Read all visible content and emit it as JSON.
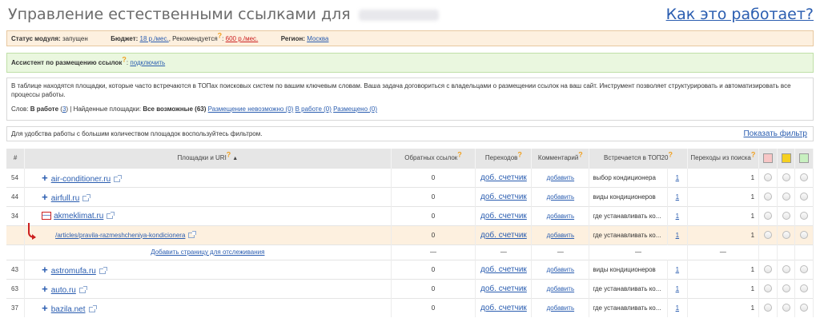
{
  "header": {
    "title": "Управление естественными ссылками для",
    "how_link": "Как это работает?"
  },
  "status": {
    "module_label": "Статус модуля:",
    "module_value": "запущен",
    "budget_label": "Бюджет:",
    "budget_value": "18 р./мес.",
    "recommended_label": "Рекомендуется",
    "recommended_value": "600 р./мес.",
    "region_label": "Регион:",
    "region_value": "Москва"
  },
  "assistant": {
    "label": "Ассистент по размещению ссылок",
    "action": "подключить"
  },
  "info": {
    "text": "В таблице находятся площадки, которые часто встречаются в ТОПах поисковых систем по вашим ключевым словам. Ваша задача договориться с владельцами о размещении ссылок на ваш сайт. Инструмент позволяет структурировать и автоматизировать все процессы работы.",
    "words_label": "Слов:",
    "in_work_label": "В работе",
    "in_work_count": "3",
    "found_label": "Найденные площадки",
    "all_possible": "Все возможные (63)",
    "impossible": "Размещение невозможно (0)",
    "in_work_sites": "В работе (0)",
    "placed": "Размещено (0)"
  },
  "filter": {
    "text": "Для удобства работы с большим количеством площадок воспользуйтесь фильтром.",
    "show_filter": "Показать фильтр"
  },
  "table": {
    "headers": {
      "num": "#",
      "sites": "Площадки и URI",
      "backlinks": "Обратных ссылок",
      "transitions": "Переходов",
      "comment": "Комментарий",
      "top20": "Встречается в ТОП20",
      "search_clicks": "Переходы из поиска"
    },
    "status_colors": [
      "#f7c6c6",
      "#f5d020",
      "#c8f0c0"
    ],
    "counter_label": "доб. счетчик",
    "add_label": "добавить",
    "rows": [
      {
        "num": "54",
        "site": "air-conditioner.ru",
        "backlinks": "0",
        "query": "выбор кондиционера",
        "top": "1",
        "clicks": "1"
      },
      {
        "num": "44",
        "site": "airfull.ru",
        "backlinks": "0",
        "query": "виды кондиционеров",
        "top": "1",
        "clicks": "1"
      },
      {
        "num": "34",
        "site": "akmeklimat.ru",
        "backlinks": "0",
        "query": "где устанавливать ко...",
        "top": "1",
        "clicks": "1"
      }
    ],
    "subrow": {
      "uri": "/articles/pravila-razmeshcheniya-kondicionera",
      "backlinks": "0",
      "query": "где устанавливать ко...",
      "top": "1",
      "clicks": "1"
    },
    "add_page": {
      "label": "Добавить страницу для отслеживания",
      "dash": "—"
    },
    "rows2": [
      {
        "num": "43",
        "site": "astromufa.ru",
        "backlinks": "0",
        "query": "виды кондиционеров",
        "top": "1",
        "clicks": "1"
      },
      {
        "num": "63",
        "site": "auto.ru",
        "backlinks": "0",
        "query": "где устанавливать ко...",
        "top": "1",
        "clicks": "1"
      },
      {
        "num": "37",
        "site": "bazila.net",
        "backlinks": "0",
        "query": "где устанавливать ко...",
        "top": "1",
        "clicks": "1"
      }
    ]
  }
}
